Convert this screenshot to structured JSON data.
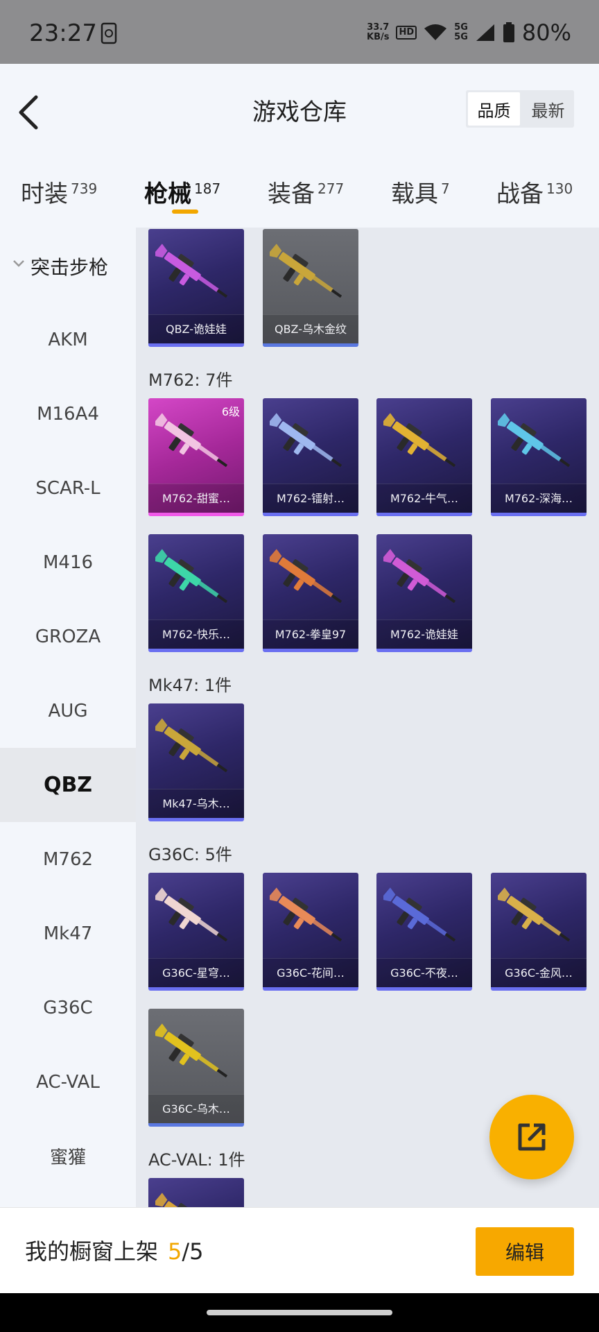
{
  "status": {
    "time": "23:27",
    "net_speed_value": "33.7",
    "net_speed_unit": "KB/s",
    "hd": "HD",
    "signal": "5G",
    "battery": "80%"
  },
  "header": {
    "title": "游戏仓库",
    "sort_options": [
      "品质",
      "最新"
    ],
    "active_sort": "品质"
  },
  "tabs": [
    {
      "label": "时装",
      "count": "739"
    },
    {
      "label": "枪械",
      "count": "187"
    },
    {
      "label": "装备",
      "count": "277"
    },
    {
      "label": "载具",
      "count": "7"
    },
    {
      "label": "战备",
      "count": "130"
    }
  ],
  "sidebar": {
    "group": "突击步枪",
    "items": [
      "AKM",
      "M16A4",
      "SCAR-L",
      "M416",
      "GROZA",
      "AUG",
      "QBZ",
      "M762",
      "Mk47",
      "G36C",
      "AC-VAL",
      "蜜獾"
    ],
    "active": "QBZ"
  },
  "sections": [
    {
      "label": "",
      "items": [
        {
          "name": "QBZ-诡娃娃",
          "style": "purple",
          "gun_color": "#c85be0"
        },
        {
          "name": "QBZ-乌木金纹",
          "style": "gray",
          "gun_color": "#c9a63a"
        }
      ]
    },
    {
      "label": "M762: 7件",
      "items": [
        {
          "name": "M762-甜蜜…",
          "style": "pink",
          "level": "6级",
          "gun_color": "#f2c4e2"
        },
        {
          "name": "M762-镭射…",
          "style": "purple",
          "gun_color": "#9fb8ef"
        },
        {
          "name": "M762-牛气…",
          "style": "purple",
          "gun_color": "#e2b233"
        },
        {
          "name": "M762-深海…",
          "style": "purple",
          "gun_color": "#5fc6e8"
        },
        {
          "name": "M762-快乐…",
          "style": "purple",
          "gun_color": "#3dd6a8"
        },
        {
          "name": "M762-拳皇97",
          "style": "purple",
          "gun_color": "#e07b3a"
        },
        {
          "name": "M762-诡娃娃",
          "style": "purple",
          "gun_color": "#d05bd6"
        }
      ]
    },
    {
      "label": "Mk47: 1件",
      "items": [
        {
          "name": "Mk47-乌木…",
          "style": "purple",
          "gun_color": "#c9a63a"
        }
      ]
    },
    {
      "label": "G36C: 5件",
      "items": [
        {
          "name": "G36C-星穹…",
          "style": "purple",
          "gun_color": "#f0d6d2"
        },
        {
          "name": "G36C-花间…",
          "style": "purple",
          "gun_color": "#e88a58"
        },
        {
          "name": "G36C-不夜…",
          "style": "purple",
          "gun_color": "#5a6ad8"
        },
        {
          "name": "G36C-金风…",
          "style": "purple",
          "gun_color": "#d9b04a"
        },
        {
          "name": "G36C-乌木…",
          "style": "gray",
          "gun_color": "#e2c21e"
        }
      ]
    },
    {
      "label": "AC-VAL: 1件",
      "items": [
        {
          "name": "",
          "style": "purple",
          "gun_color": "#d9a53a"
        }
      ]
    }
  ],
  "bottom": {
    "showcase_label": "我的橱窗上架",
    "used": "5",
    "total": "/5",
    "edit_label": "编辑"
  },
  "colors": {
    "accent": "#f7a800",
    "card_purple": "#2e2768",
    "card_pink": "#a52899",
    "card_gray": "#5f6166"
  }
}
